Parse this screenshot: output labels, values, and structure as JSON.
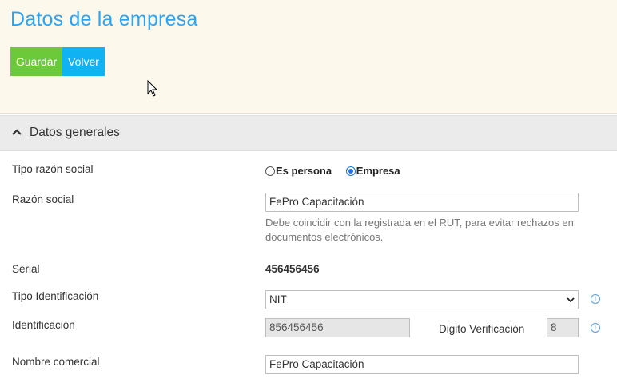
{
  "header": {
    "title": "Datos de la empresa",
    "save_label": "Guardar",
    "back_label": "Volver"
  },
  "section": {
    "title": "Datos generales"
  },
  "form": {
    "tipo_razon_social": {
      "label": "Tipo razón social",
      "options": [
        "Es persona",
        "Empresa"
      ],
      "selected": "Empresa"
    },
    "razon_social": {
      "label": "Razón social",
      "value": "FePro Capacitación",
      "help": "Debe coincidir con la registrada en el RUT, para evitar rechazos en documentos electrónicos."
    },
    "serial": {
      "label": "Serial",
      "value": "456456456"
    },
    "tipo_identificacion": {
      "label": "Tipo Identificación",
      "value": "NIT"
    },
    "identificacion": {
      "label": "Identificación",
      "value": "856456456",
      "digito_label": "Digito Verificación",
      "digito_value": "8"
    },
    "nombre_comercial": {
      "label": "Nombre comercial",
      "value": "FePro Capacitación"
    }
  },
  "colors": {
    "title": "#2ea3f2",
    "save_button": "#6cc93a",
    "back_button": "#10b2f4",
    "header_bg": "#fdf8ec",
    "section_bg": "#ebebeb"
  },
  "icons": [
    "chevron-up-icon",
    "info-icon",
    "select-arrow-icon",
    "mouse-cursor-icon"
  ]
}
